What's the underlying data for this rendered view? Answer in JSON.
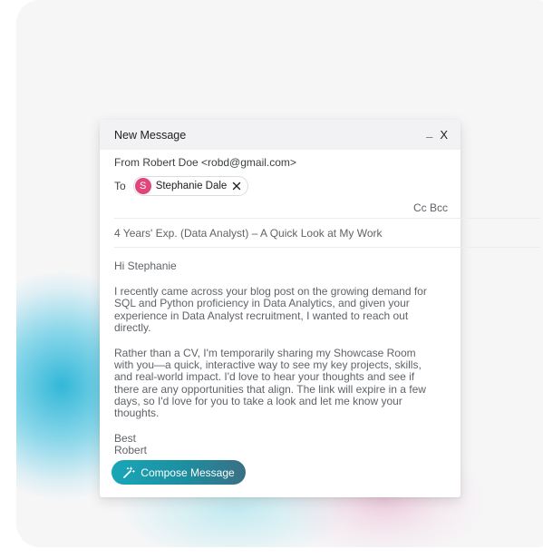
{
  "window": {
    "title": "New Message",
    "minimize_glyph": "_",
    "close_glyph": "X"
  },
  "from": {
    "text": "From Robert Doe <robd@gmail.com>"
  },
  "to": {
    "label": "To",
    "recipient": {
      "initial": "S",
      "name": "Stephanie Dale",
      "avatar_color": "#e0457b"
    }
  },
  "cc_bcc": {
    "cc": "Cc",
    "bcc": "Bcc"
  },
  "subject": "4 Years' Exp. (Data Analyst) – A Quick Look at My Work",
  "body": {
    "greeting": "Hi Stephanie",
    "paragraph1": "I recently came across your blog post on the growing demand for SQL and Python proficiency in Data Analytics, and given your experience in Data Analyst recruitment, I wanted to reach out directly.",
    "paragraph2": "Rather than a CV, I'm temporarily sharing my Showcase Room with you—a quick, interactive way to see my key projects, skills, and real-world impact. I'd love to hear your thoughts and see if there are any opportunities that align. The link will expire in a few days, so I'd love for you to take a look and let me know your thoughts.",
    "signoff": "Best",
    "signature": "Robert"
  },
  "compose_button": {
    "label": "Compose Message",
    "icon": "magic-wand-icon"
  },
  "colors": {
    "accent_start": "#18a7b8",
    "accent_end": "#3a6f85",
    "chip_avatar": "#e0457b",
    "titlebar": "#f2f2f4"
  }
}
